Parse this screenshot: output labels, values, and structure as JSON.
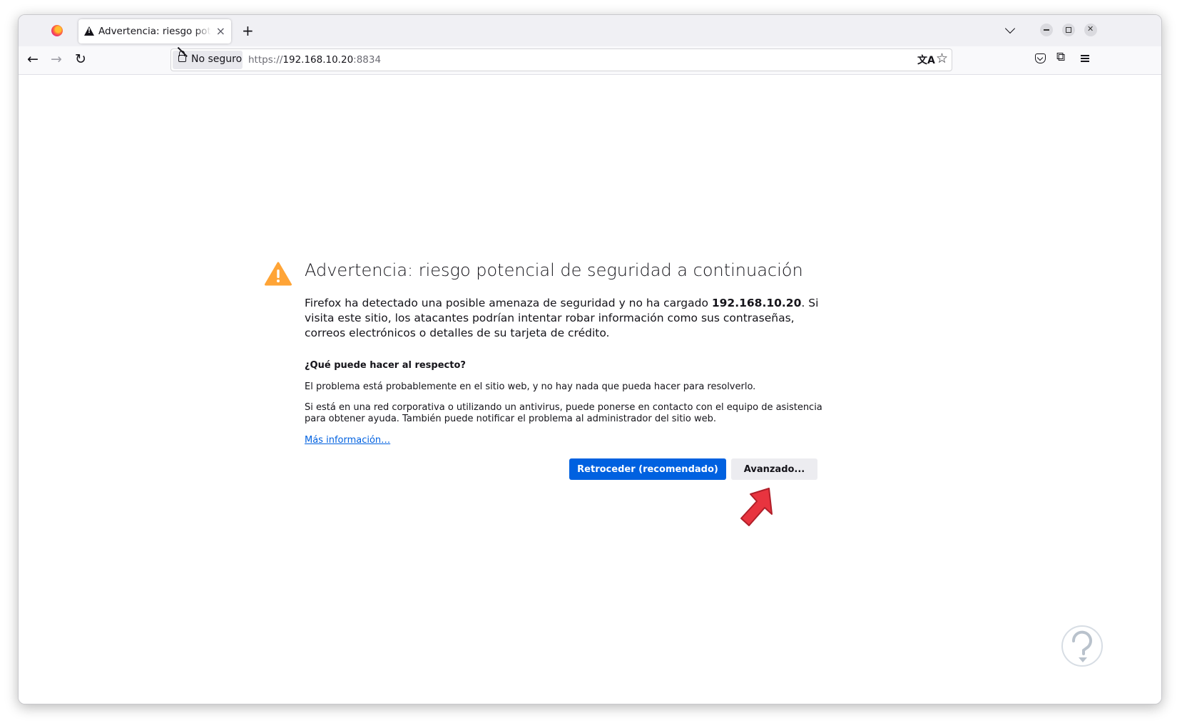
{
  "browser": {
    "tab": {
      "title": "Advertencia: riesgo poten",
      "close": "×"
    },
    "new_tab": "+",
    "nav": {
      "back": "←",
      "forward": "→",
      "reload": "↻"
    },
    "identity_label": "No seguro",
    "url": {
      "scheme": "https://",
      "host": "192.168.10.20",
      "port": ":8834"
    },
    "translate_glyph": "文A",
    "bookmark_glyph": "☆",
    "extensions_glyph": "⧉"
  },
  "page": {
    "title": "Advertencia: riesgo potencial de seguridad a continuación",
    "intro_before": "Firefox ha detectado una posible amenaza de seguridad y no ha cargado ",
    "intro_host": "192.168.10.20",
    "intro_after": ". Si visita este sitio, los atacantes podrían intentar robar información como sus contraseñas, correos electrónicos o detalles de su tarjeta de crédito.",
    "subheading": "¿Qué puede hacer al respecto?",
    "paragraph1": "El problema está probablemente en el sitio web, y no hay nada que pueda hacer para resolverlo.",
    "paragraph2": "Si está en una red corporativa o utilizando un antivirus, puede ponerse en contacto con el equipo de asistencia para obtener ayuda. También puede notificar el problema al administrador del sitio web.",
    "more_info": "Más información…",
    "btn_back": "Retroceder (recomendado)",
    "btn_advanced": "Avanzado..."
  },
  "colors": {
    "primary_button": "#0061e0",
    "warning": "#ffa436",
    "annotation_arrow": "#e8343f"
  }
}
